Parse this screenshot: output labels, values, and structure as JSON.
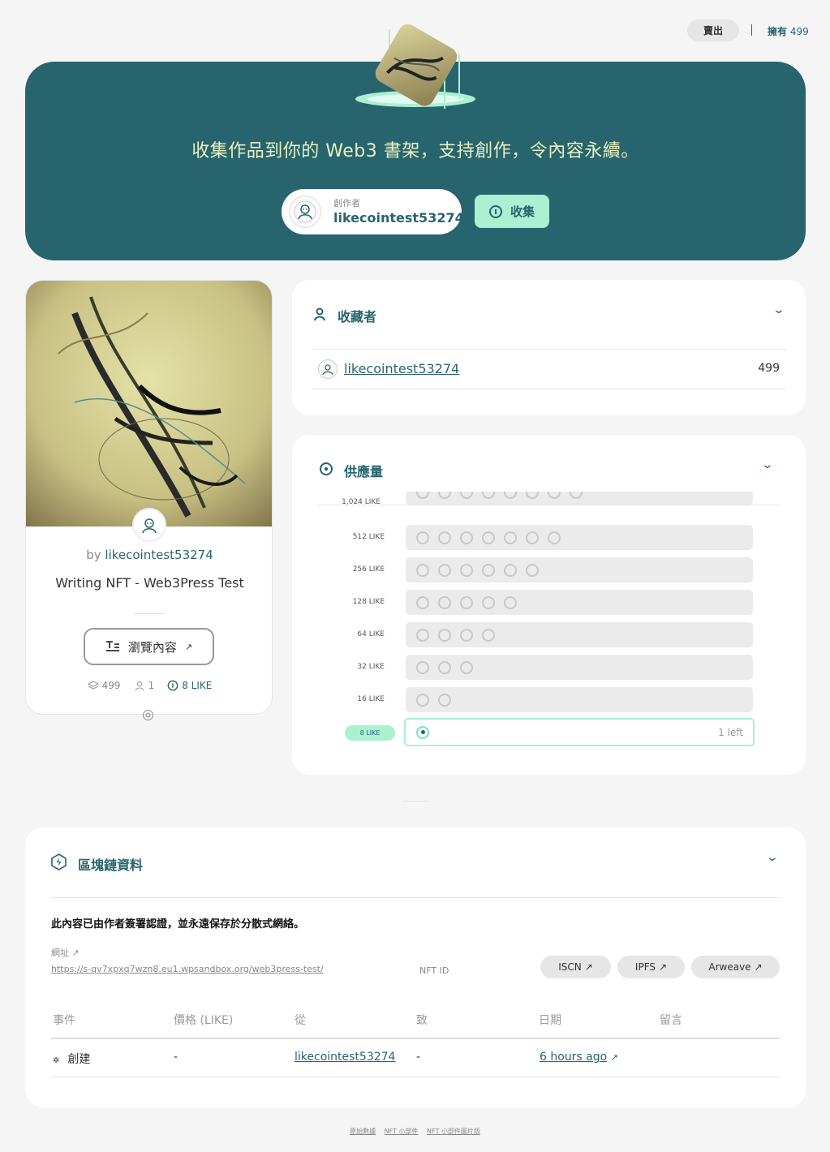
{
  "topbar": {
    "sell_label": "賣出",
    "own_label": "擁有",
    "own_count": "499"
  },
  "hero": {
    "title": "收集作品到你的 Web3 書架，支持創作，令內容永續。",
    "creator_label": "創作者",
    "creator_name": "likecointest53274",
    "collect_label": "收集"
  },
  "nft_card": {
    "by_prefix": "by",
    "creator": "likecointest53274",
    "title": "Writing NFT - Web3Press Test",
    "browse_label": "瀏覽內容",
    "stats": {
      "supply": "499",
      "owners": "1",
      "price": "8 LIKE"
    }
  },
  "collectors": {
    "title": "收藏者",
    "rows": [
      {
        "name": "likecointest53274",
        "count": "499"
      }
    ]
  },
  "supply": {
    "title": "供應量",
    "partial_tier": "1,024 LIKE",
    "tiers": [
      {
        "label": "512 LIKE",
        "slots": 7
      },
      {
        "label": "256 LIKE",
        "slots": 6
      },
      {
        "label": "128 LIKE",
        "slots": 5
      },
      {
        "label": "64 LIKE",
        "slots": 4
      },
      {
        "label": "32 LIKE",
        "slots": 3
      },
      {
        "label": "16 LIKE",
        "slots": 2
      }
    ],
    "active_tier": {
      "label": "8 LIKE",
      "left_text": "1 left"
    }
  },
  "blockchain": {
    "title": "區塊鏈資料",
    "description": "此內容已由作者簽署認證，並永遠保存於分散式網絡。",
    "url_label": "網址",
    "url": "https://s-qv7xpxq7wzn8.eu1.wpsandbox.org/web3press-test/",
    "nft_id_label": "NFT ID",
    "chips": [
      "ISCN",
      "IPFS",
      "Arweave"
    ],
    "table_headers": [
      "事件",
      "價格 (LIKE)",
      "從",
      "致",
      "日期",
      "留言"
    ],
    "rows": [
      {
        "event": "創建",
        "price": "-",
        "from": "likecointest53274",
        "to": "-",
        "date": "6 hours ago"
      }
    ]
  },
  "footer": {
    "links": [
      "原始數據",
      "NFT 小部件",
      "NFT 小部件圖片版"
    ]
  },
  "colors": {
    "brand": "#28646e",
    "accent": "#aaf0d1",
    "hero_text": "#e8f3c0"
  }
}
